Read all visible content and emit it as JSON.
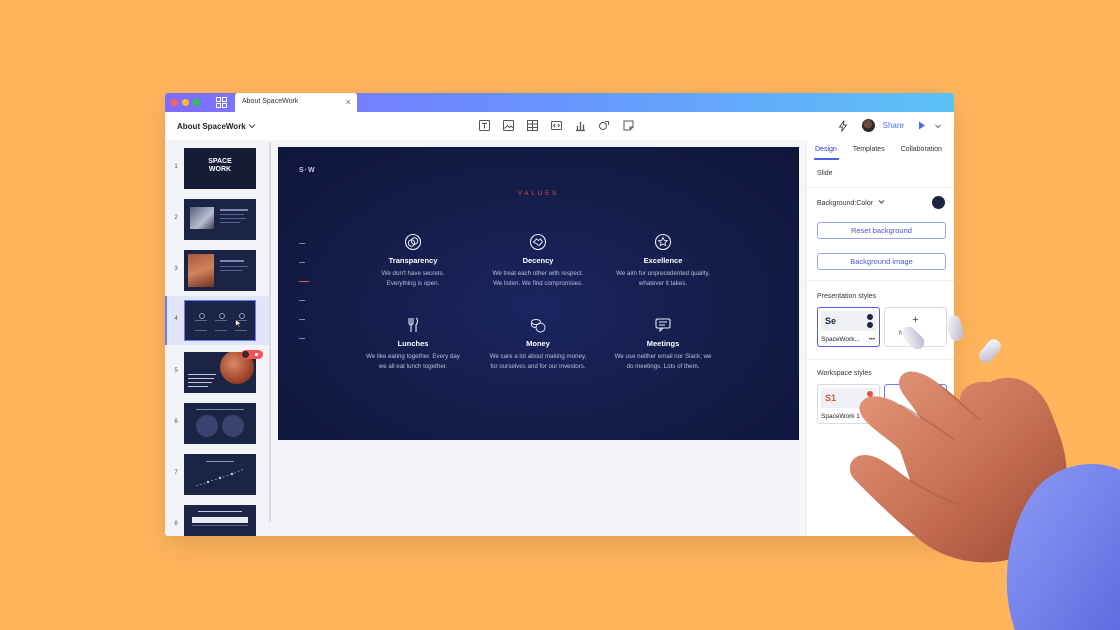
{
  "window": {
    "tab_title": "About SpaceWork",
    "tab_close": "×"
  },
  "toolbar": {
    "doc_title": "About SpaceWork",
    "share_label": "Share"
  },
  "slides": [
    {
      "number": "1",
      "title_line1": "SPACE",
      "title_line2": "WORK"
    },
    {
      "number": "2"
    },
    {
      "number": "3"
    },
    {
      "number": "4"
    },
    {
      "number": "5"
    },
    {
      "number": "6"
    },
    {
      "number": "7"
    },
    {
      "number": "8"
    }
  ],
  "slide": {
    "logo": "S·W",
    "section_title": "VALUES",
    "items": [
      {
        "title": "Transparency",
        "desc1": "We don't have secrets.",
        "desc2": "Everything is open.",
        "icon": "transparency-icon"
      },
      {
        "title": "Decency",
        "desc1": "We treat each other with respect.",
        "desc2": "We listen. We find compromises.",
        "icon": "handshake-icon"
      },
      {
        "title": "Excellence",
        "desc1": "We aim for unprecedented quality,",
        "desc2": "whatever it takes.",
        "icon": "star-badge-icon"
      },
      {
        "title": "Lunches",
        "desc1": "We like eating together. Every day",
        "desc2": "we all eat lunch together.",
        "icon": "cutlery-icon"
      },
      {
        "title": "Money",
        "desc1": "We care a lot about making money,",
        "desc2": "for ourselves and for our investors.",
        "icon": "coins-icon"
      },
      {
        "title": "Meetings",
        "desc1": "We use neither email nor Slack; we",
        "desc2": "do meetings. Lots of them.",
        "icon": "chat-icon"
      }
    ]
  },
  "panel": {
    "tabs": [
      "Design",
      "Templates",
      "Collaboration"
    ],
    "slide_label": "Slide",
    "background_label": "Background:",
    "background_value": "Color",
    "reset_background": "Reset background",
    "background_image": "Background image",
    "presentation_styles_label": "Presentation styles",
    "presentation_style_abbr": "Se",
    "presentation_style_name": "SpaceWork...",
    "new_style_label": "New",
    "workspace_styles_label": "Workspace styles",
    "workspace_style_abbr": "S1",
    "workspace_style_name": "SpaceWork 1"
  },
  "colors": {
    "background": "#FFB55C",
    "accent": "#4C5DF0",
    "slide_bg": "#141C48",
    "values_red": "#E0543E"
  }
}
